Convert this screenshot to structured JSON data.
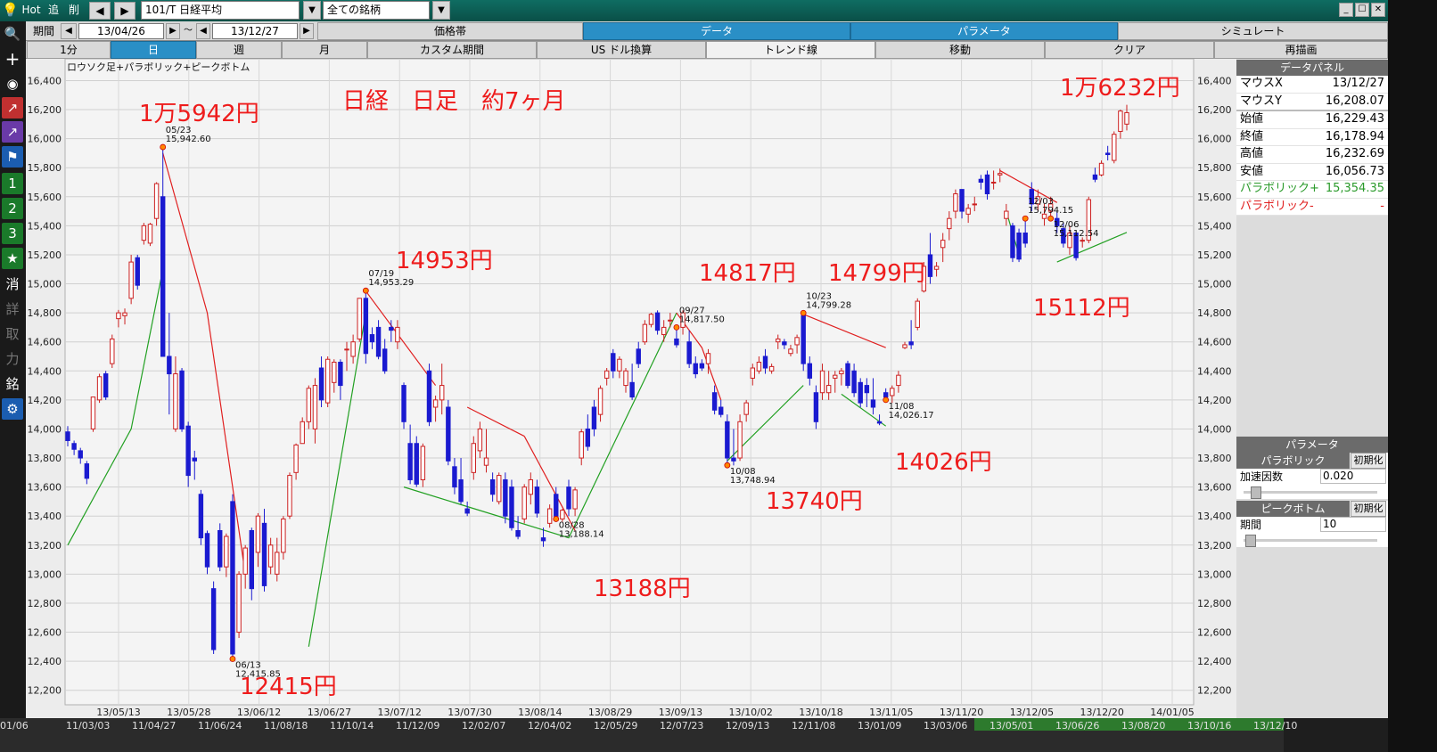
{
  "toolbar": {
    "hot": "Hot",
    "tsui": "追",
    "sakujo": "削",
    "symbol": "101/T 日経平均",
    "universe": "全ての銘柄",
    "period_label": "期間",
    "date_from": "13/04/26",
    "tilde": "～",
    "date_to": "13/12/27",
    "tabs_top": [
      "価格帯",
      "データ",
      "パラメータ",
      "シミュレート"
    ],
    "interval_tabs": [
      "1分",
      "日",
      "週",
      "月"
    ],
    "sub_tabs": [
      "カスタム期間",
      "US ドル換算",
      "トレンド線",
      "移動",
      "クリア",
      "再描画"
    ],
    "win_buttons": [
      "_",
      "☐",
      "✕"
    ]
  },
  "left_tools": [
    "search-icon",
    "plus-icon",
    "camera-icon",
    "chart-icon",
    "chart2-icon",
    "flag-icon",
    "1",
    "2",
    "3",
    "★",
    "消",
    "詳",
    "取",
    "力",
    "銘",
    "gear-icon"
  ],
  "chart_data": {
    "type": "candlestick",
    "title": "日経　日足　約7ヶ月",
    "legend": "ロウソク足+パラボリック+ピークボトム",
    "ylim": [
      12100,
      16550
    ],
    "yticks": [
      12200,
      12400,
      12600,
      12800,
      13000,
      13200,
      13400,
      13600,
      13800,
      14000,
      14200,
      14400,
      14600,
      14800,
      15000,
      15200,
      15400,
      15600,
      15800,
      16000,
      16200,
      16400
    ],
    "ytick_labels": [
      "12,200",
      "12,400",
      "12,600",
      "12,800",
      "13,000",
      "13,200",
      "13,400",
      "13,600",
      "13,800",
      "14,000",
      "14,200",
      "14,400",
      "14,600",
      "14,800",
      "15,000",
      "15,200",
      "15,400",
      "15,600",
      "15,800",
      "16,000",
      "16,200",
      "16,400"
    ],
    "xticks": [
      "13/05/13",
      "13/05/28",
      "13/06/12",
      "13/06/27",
      "13/07/12",
      "13/07/30",
      "13/08/14",
      "13/08/29",
      "13/09/13",
      "13/10/02",
      "13/10/18",
      "13/11/05",
      "13/11/20",
      "13/12/05",
      "13/12/20",
      "14/01/05"
    ],
    "bottom_dates": [
      "01/06",
      "11/03/03",
      "11/04/27",
      "11/06/24",
      "11/08/18",
      "11/10/14",
      "11/12/09",
      "12/02/07",
      "12/04/02",
      "12/05/29",
      "12/07/23",
      "12/09/13",
      "12/11/08",
      "13/01/09",
      "13/03/06",
      "13/05/01",
      "13/06/26",
      "13/08/20",
      "13/10/16",
      "13/12/10"
    ],
    "candles": [
      [
        13980,
        14020,
        13880,
        13920
      ],
      [
        13900,
        13920,
        13820,
        13860
      ],
      [
        13850,
        13870,
        13760,
        13800
      ],
      [
        13760,
        13780,
        13620,
        13660
      ],
      [
        14000,
        14220,
        13980,
        14220
      ],
      [
        14200,
        14380,
        14180,
        14360
      ],
      [
        14380,
        14400,
        14200,
        14220
      ],
      [
        14450,
        14650,
        14420,
        14620
      ],
      [
        14760,
        14820,
        14700,
        14800
      ],
      [
        14780,
        14830,
        14720,
        14800
      ],
      [
        14900,
        15200,
        14860,
        15150
      ],
      [
        15180,
        15200,
        14960,
        14990
      ],
      [
        15300,
        15420,
        15270,
        15400
      ],
      [
        15280,
        15420,
        15260,
        15410
      ],
      [
        15450,
        15700,
        15400,
        15690
      ],
      [
        15600,
        15942,
        14500,
        14500
      ],
      [
        14500,
        14800,
        14100,
        14380
      ],
      [
        14000,
        14500,
        13980,
        14380
      ],
      [
        14400,
        14420,
        13980,
        14000
      ],
      [
        14020,
        14050,
        13600,
        13680
      ],
      [
        13800,
        13850,
        13650,
        13780
      ],
      [
        13550,
        13580,
        13200,
        13250
      ],
      [
        13280,
        13300,
        13000,
        13050
      ],
      [
        12900,
        12950,
        12450,
        12480
      ],
      [
        13300,
        13350,
        13020,
        13050
      ],
      [
        13050,
        13280,
        12980,
        13260
      ],
      [
        13500,
        13550,
        12416,
        12450
      ],
      [
        12600,
        13020,
        12560,
        13000
      ],
      [
        13000,
        13200,
        12900,
        13180
      ],
      [
        13300,
        13320,
        12820,
        12900
      ],
      [
        13150,
        13420,
        13050,
        13400
      ],
      [
        13350,
        13450,
        12880,
        12920
      ],
      [
        13050,
        13250,
        13000,
        13200
      ],
      [
        13000,
        13250,
        12950,
        13150
      ],
      [
        13150,
        13400,
        13100,
        13380
      ],
      [
        13400,
        13700,
        13380,
        13680
      ],
      [
        13700,
        13900,
        13650,
        13890
      ],
      [
        13900,
        14080,
        13900,
        14050
      ],
      [
        14050,
        14300,
        14000,
        14280
      ],
      [
        14000,
        14350,
        13900,
        14300
      ],
      [
        14420,
        14500,
        14150,
        14200
      ],
      [
        14180,
        14500,
        14150,
        14480
      ],
      [
        14320,
        14480,
        14250,
        14460
      ],
      [
        14460,
        14480,
        14200,
        14300
      ],
      [
        14550,
        14600,
        14400,
        14550
      ],
      [
        14500,
        14650,
        14450,
        14600
      ],
      [
        14620,
        14900,
        14600,
        14900
      ],
      [
        14900,
        14953,
        14450,
        14520
      ],
      [
        14650,
        14700,
        14550,
        14600
      ],
      [
        14700,
        14750,
        14480,
        14500
      ],
      [
        14550,
        14620,
        14380,
        14400
      ],
      [
        14700,
        14750,
        14600,
        14680
      ],
      [
        14600,
        14750,
        14550,
        14700
      ],
      [
        14300,
        14320,
        14000,
        14050
      ],
      [
        13900,
        14030,
        13620,
        13650
      ],
      [
        13900,
        13950,
        13600,
        13620
      ],
      [
        13650,
        13900,
        13600,
        13880
      ],
      [
        14400,
        14450,
        14020,
        14050
      ],
      [
        14150,
        14230,
        14050,
        14200
      ],
      [
        14200,
        14450,
        14100,
        14300
      ],
      [
        14150,
        14200,
        13750,
        13780
      ],
      [
        13740,
        13800,
        13550,
        13600
      ],
      [
        13650,
        13800,
        13480,
        13500
      ],
      [
        13450,
        13500,
        13400,
        13420
      ],
      [
        13700,
        13950,
        13650,
        13900
      ],
      [
        13850,
        14050,
        13800,
        14000
      ],
      [
        13750,
        14000,
        13700,
        13800
      ],
      [
        13650,
        13700,
        13500,
        13550
      ],
      [
        13500,
        13700,
        13480,
        13680
      ],
      [
        13650,
        13700,
        13350,
        13400
      ],
      [
        13600,
        13650,
        13300,
        13320
      ],
      [
        13300,
        13400,
        13240,
        13260
      ],
      [
        13380,
        13620,
        13350,
        13600
      ],
      [
        13550,
        13700,
        13480,
        13650
      ],
      [
        13600,
        13650,
        13390,
        13420
      ],
      [
        13250,
        13320,
        13188,
        13230
      ],
      [
        13350,
        13480,
        13320,
        13450
      ],
      [
        13550,
        13600,
        13380,
        13400
      ],
      [
        13380,
        13450,
        13360,
        13440
      ],
      [
        13600,
        13650,
        13400,
        13450
      ],
      [
        13450,
        13600,
        13400,
        13580
      ],
      [
        13800,
        14000,
        13750,
        13980
      ],
      [
        14000,
        14100,
        13850,
        13880
      ],
      [
        14150,
        14200,
        13950,
        14000
      ],
      [
        14100,
        14300,
        14050,
        14280
      ],
      [
        14350,
        14420,
        14300,
        14400
      ],
      [
        14520,
        14550,
        14350,
        14400
      ],
      [
        14400,
        14500,
        14350,
        14480
      ],
      [
        14300,
        14420,
        14250,
        14400
      ],
      [
        14320,
        14450,
        14200,
        14220
      ],
      [
        14550,
        14600,
        14420,
        14450
      ],
      [
        14600,
        14750,
        14580,
        14720
      ],
      [
        14720,
        14800,
        14700,
        14790
      ],
      [
        14800,
        14817,
        14650,
        14680
      ],
      [
        14650,
        14750,
        14600,
        14700
      ],
      [
        14750,
        14800,
        14700,
        14750
      ],
      [
        14620,
        14700,
        14560,
        14580
      ],
      [
        14700,
        14817,
        14650,
        14800
      ],
      [
        14600,
        14680,
        14420,
        14450
      ],
      [
        14450,
        14500,
        14350,
        14380
      ],
      [
        14450,
        14480,
        14400,
        14420
      ],
      [
        14450,
        14550,
        14380,
        14520
      ],
      [
        14250,
        14300,
        14100,
        14130
      ],
      [
        14150,
        14200,
        14080,
        14100
      ],
      [
        14050,
        14100,
        13750,
        13800
      ],
      [
        13800,
        14000,
        13749,
        13780
      ],
      [
        13800,
        14100,
        13780,
        14050
      ],
      [
        14100,
        14200,
        14050,
        14180
      ],
      [
        14350,
        14450,
        14300,
        14420
      ],
      [
        14400,
        14500,
        14380,
        14460
      ],
      [
        14500,
        14550,
        14380,
        14420
      ],
      [
        14400,
        14450,
        14380,
        14430
      ],
      [
        14600,
        14650,
        14550,
        14620
      ],
      [
        14600,
        14620,
        14550,
        14580
      ],
      [
        14520,
        14580,
        14500,
        14550
      ],
      [
        14580,
        14650,
        14520,
        14630
      ],
      [
        14780,
        14799,
        14400,
        14450
      ],
      [
        14450,
        14500,
        14300,
        14350
      ],
      [
        14250,
        14300,
        14000,
        14050
      ],
      [
        14250,
        14450,
        14200,
        14400
      ],
      [
        14250,
        14400,
        14200,
        14300
      ],
      [
        14350,
        14400,
        14250,
        14370
      ],
      [
        14380,
        14420,
        14300,
        14400
      ],
      [
        14450,
        14470,
        14280,
        14300
      ],
      [
        14400,
        14450,
        14220,
        14250
      ],
      [
        14320,
        14350,
        14150,
        14180
      ],
      [
        14300,
        14350,
        14150,
        14250
      ],
      [
        14200,
        14350,
        14100,
        14150
      ],
      [
        14050,
        14100,
        14026,
        14040
      ],
      [
        14250,
        14280,
        14200,
        14220
      ],
      [
        14230,
        14300,
        14180,
        14280
      ],
      [
        14300,
        14400,
        14250,
        14370
      ],
      [
        14560,
        14600,
        14550,
        14580
      ],
      [
        14600,
        14750,
        14550,
        14580
      ],
      [
        14700,
        14900,
        14680,
        14880
      ],
      [
        14950,
        15150,
        14940,
        15120
      ],
      [
        15200,
        15350,
        15000,
        15050
      ],
      [
        15100,
        15150,
        15050,
        15120
      ],
      [
        15250,
        15350,
        15150,
        15300
      ],
      [
        15380,
        15500,
        15300,
        15450
      ],
      [
        15500,
        15650,
        15450,
        15620
      ],
      [
        15650,
        15650,
        15450,
        15500
      ],
      [
        15480,
        15550,
        15420,
        15520
      ],
      [
        15550,
        15600,
        15500,
        15550
      ],
      [
        15720,
        15750,
        15650,
        15700
      ],
      [
        15750,
        15780,
        15580,
        15620
      ],
      [
        15700,
        15780,
        15650,
        15700
      ],
      [
        15750,
        15794,
        15700,
        15760
      ],
      [
        15450,
        15550,
        15400,
        15500
      ],
      [
        15400,
        15420,
        15150,
        15180
      ],
      [
        15350,
        15380,
        15150,
        15170
      ],
      [
        15350,
        15450,
        15250,
        15280
      ],
      [
        15650,
        15700,
        15500,
        15550
      ],
      [
        15550,
        15650,
        15500,
        15600
      ],
      [
        15450,
        15550,
        15400,
        15480
      ],
      [
        15500,
        15600,
        15450,
        15550
      ],
      [
        15450,
        15500,
        15350,
        15400
      ],
      [
        15380,
        15420,
        15250,
        15280
      ],
      [
        15250,
        15400,
        15200,
        15350
      ],
      [
        15350,
        15360,
        15160,
        15180
      ],
      [
        15300,
        15320,
        15250,
        15300
      ],
      [
        15300,
        15600,
        15280,
        15580
      ],
      [
        15750,
        15800,
        15700,
        15720
      ],
      [
        15750,
        15850,
        15740,
        15830
      ],
      [
        15900,
        15950,
        15850,
        15890
      ],
      [
        15850,
        16050,
        15830,
        16030
      ],
      [
        16050,
        16200,
        16000,
        16190
      ],
      [
        16100,
        16233,
        16057,
        16179
      ]
    ],
    "parabolic_plus": [
      [
        0,
        13200
      ],
      [
        10,
        14000
      ],
      [
        15,
        15100
      ],
      [
        38,
        12500
      ],
      [
        47,
        14800
      ],
      [
        53,
        13600
      ],
      [
        79,
        13250
      ],
      [
        96,
        14800
      ],
      [
        104,
        13780
      ],
      [
        116,
        14300
      ],
      [
        122,
        14240
      ],
      [
        129,
        14020
      ],
      [
        148,
        15500
      ],
      [
        150,
        15200
      ],
      [
        156,
        15150
      ],
      [
        167,
        15354
      ]
    ],
    "parabolic_minus": [
      [
        15,
        15900
      ],
      [
        22,
        14800
      ],
      [
        28,
        13000
      ],
      [
        47,
        14950
      ],
      [
        58,
        14300
      ],
      [
        63,
        14150
      ],
      [
        72,
        13950
      ],
      [
        80,
        13300
      ],
      [
        96,
        14800
      ],
      [
        100,
        14560
      ],
      [
        103,
        14200
      ],
      [
        116,
        14790
      ],
      [
        129,
        14560
      ],
      [
        147,
        15780
      ],
      [
        156,
        15560
      ]
    ],
    "peaks": [
      {
        "i": 15,
        "date": "05/23",
        "value": "15,942.60",
        "label": "1万5942円",
        "type": "high"
      },
      {
        "i": 26,
        "date": "06/13",
        "value": "12,415.85",
        "label": "12415円",
        "type": "low"
      },
      {
        "i": 47,
        "date": "07/19",
        "value": "14,953.29",
        "label": "14953円",
        "type": "high"
      },
      {
        "i": 77,
        "date": "08/28",
        "value": "13,188.14",
        "label": "13188円",
        "type": "low"
      },
      {
        "i": 96,
        "date": "09/27",
        "value": "14,817.50",
        "label": "14817円",
        "type": "high"
      },
      {
        "i": 104,
        "date": "10/08",
        "value": "13,748.94",
        "label": "13740円",
        "type": "low"
      },
      {
        "i": 116,
        "date": "10/23",
        "value": "14,799.28",
        "label": "14799円",
        "type": "high"
      },
      {
        "i": 129,
        "date": "11/08",
        "value": "14,026.17",
        "label": "14026円",
        "type": "low"
      },
      {
        "i": 151,
        "date": "12/03",
        "value": "15,794.15",
        "label": "",
        "type": "high"
      },
      {
        "i": 155,
        "date": "12/06",
        "value": "15,112.54",
        "label": "15112円",
        "type": "low"
      }
    ],
    "last_label": "1万6232円"
  },
  "data_panel": {
    "header": "データパネル",
    "rows": [
      {
        "k": "マウスX",
        "v": "13/12/27"
      },
      {
        "k": "マウスY",
        "v": "16,208.07"
      },
      {
        "k": "始値",
        "v": "16,229.43"
      },
      {
        "k": "終値",
        "v": "16,178.94"
      },
      {
        "k": "高値",
        "v": "16,232.69"
      },
      {
        "k": "安値",
        "v": "16,056.73"
      },
      {
        "k": "パラボリック+",
        "v": "15,354.35"
      },
      {
        "k": "パラボリック-",
        "v": "-"
      }
    ]
  },
  "param_panel": {
    "header": "パラメータ",
    "parabolic": "パラボリック",
    "reset": "初期化",
    "accel_label": "加速因数",
    "accel_value": "0.020",
    "peak": "ピークボトム",
    "period_label": "期間",
    "period_value": "10"
  },
  "colors": {
    "up": "#cc2020",
    "down": "#1a1ad0",
    "par_plus": "#22a022",
    "par_minus": "#e02020",
    "annot": "#ee1c1c"
  }
}
